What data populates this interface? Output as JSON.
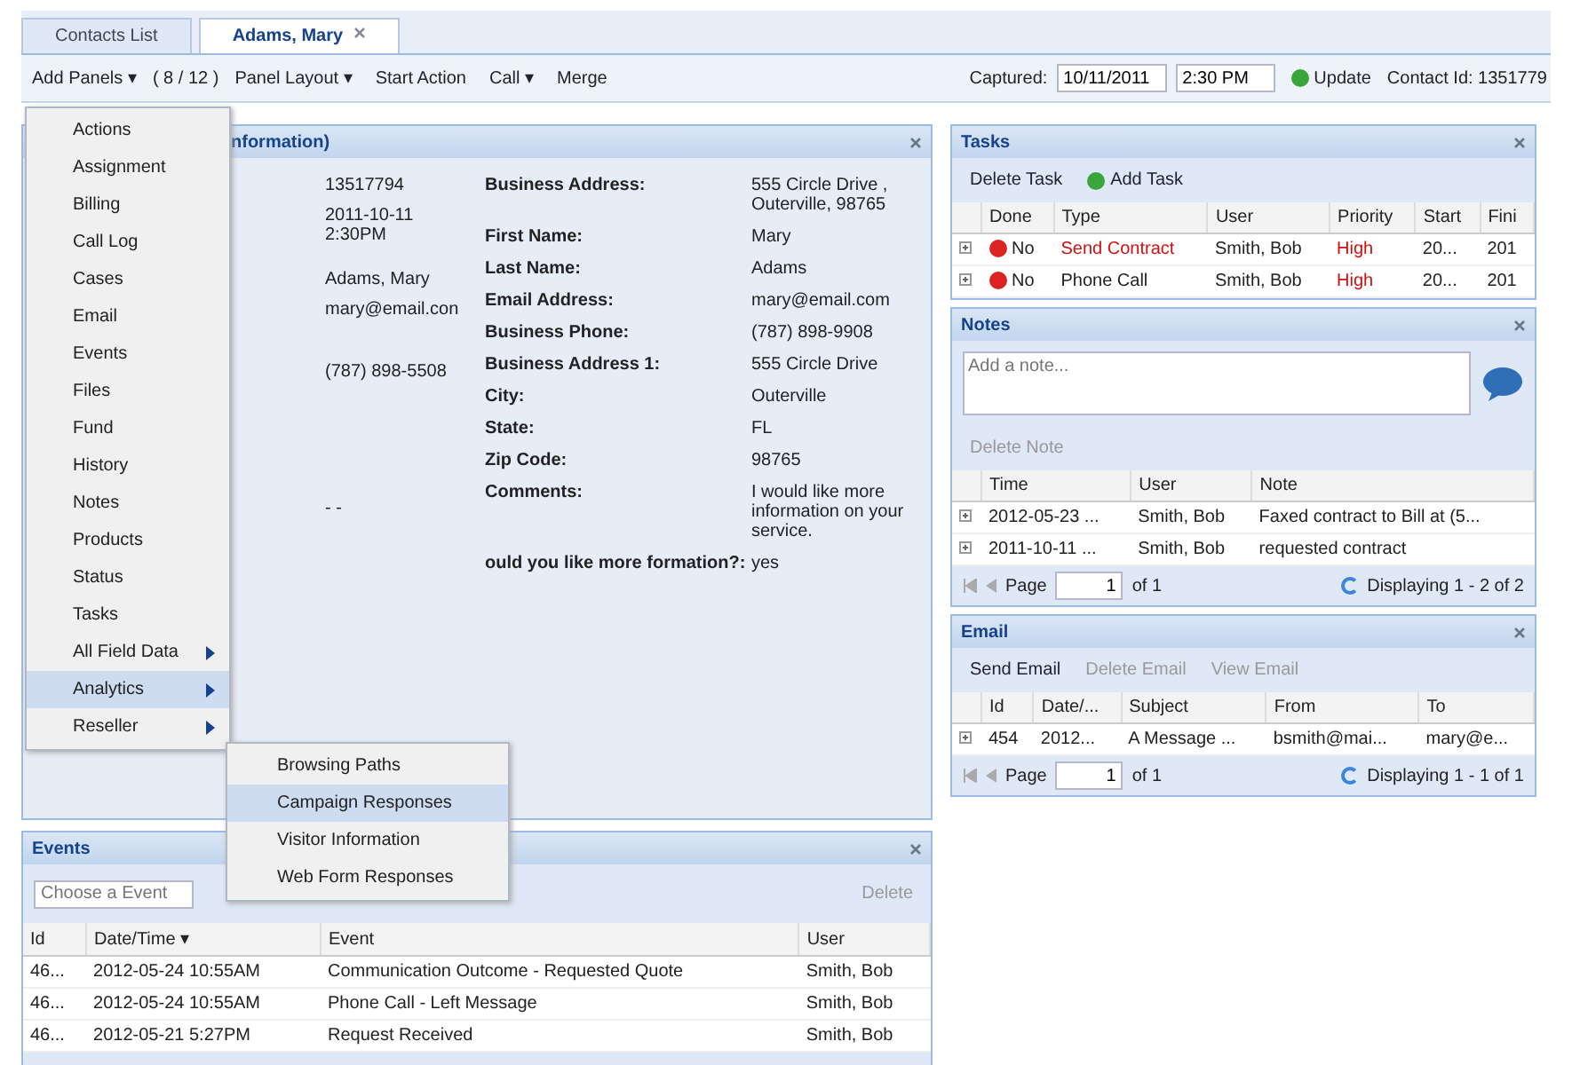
{
  "tabs": [
    {
      "label": "Contacts List",
      "selected": false,
      "closable": false
    },
    {
      "label": "Adams, Mary",
      "selected": true,
      "closable": true
    }
  ],
  "toolbar": {
    "add_panels": "Add Panels ▾",
    "panel_count": "( 8 / 12 )",
    "panel_layout": "Panel Layout ▾",
    "start_action": "Start Action",
    "call": "Call ▾",
    "merge": "Merge",
    "captured_label": "Captured:",
    "captured_date": "10/11/2011",
    "captured_time": "2:30 PM",
    "update": "Update",
    "contact_id": "Contact Id: 1351779"
  },
  "contact_panel": {
    "title": "nformation)",
    "left_values": [
      "13517794",
      "2011-10-11 2:30PM",
      "Adams, Mary",
      "mary@email.con",
      "(787) 898-5508",
      "- -"
    ],
    "fields": [
      {
        "label": "Business Address:",
        "value": "555 Circle Drive , Outerville, 98765"
      },
      {
        "label": "First Name:",
        "value": "Mary"
      },
      {
        "label": "Last Name:",
        "value": "Adams"
      },
      {
        "label": "Email Address:",
        "value": "mary@email.com"
      },
      {
        "label": "Business Phone:",
        "value": "(787) 898-9908"
      },
      {
        "label": "Business Address 1:",
        "value": "555 Circle Drive"
      },
      {
        "label": "City:",
        "value": "Outerville"
      },
      {
        "label": "State:",
        "value": "FL"
      },
      {
        "label": "Zip Code:",
        "value": "98765"
      },
      {
        "label": "Comments:",
        "value": "I would like more information on your service."
      },
      {
        "label": "ould you like more formation?:",
        "value": "yes"
      }
    ]
  },
  "events_panel": {
    "title": "Events",
    "combo_placeholder": "Choose a Event",
    "delete": "Delete",
    "columns": [
      "Id",
      "Date/Time ▾",
      "Event",
      "User"
    ],
    "rows": [
      [
        "46...",
        "2012-05-24 10:55AM",
        "Communication Outcome - Requested Quote",
        "Smith, Bob"
      ],
      [
        "46...",
        "2012-05-24 10:55AM",
        "Phone Call - Left Message",
        "Smith, Bob"
      ],
      [
        "46...",
        "2012-05-21 5:27PM",
        "Request Received",
        "Smith, Bob"
      ]
    ]
  },
  "menu": {
    "items": [
      {
        "label": "Actions",
        "kind": "item"
      },
      {
        "label": "Assignment",
        "kind": "item"
      },
      {
        "label": "Billing",
        "kind": "item"
      },
      {
        "label": "Call Log",
        "kind": "item"
      },
      {
        "label": "Cases",
        "kind": "item"
      },
      {
        "label": "Email",
        "kind": "item"
      },
      {
        "label": "Events",
        "kind": "item"
      },
      {
        "label": "Files",
        "kind": "item"
      },
      {
        "label": "Fund",
        "kind": "item"
      },
      {
        "label": "History",
        "kind": "item"
      },
      {
        "label": "Notes",
        "kind": "item"
      },
      {
        "label": "Products",
        "kind": "item"
      },
      {
        "label": "Status",
        "kind": "item"
      },
      {
        "label": "Tasks",
        "kind": "item"
      },
      {
        "label": "All Field Data",
        "kind": "submenu",
        "selected": false
      },
      {
        "label": "Analytics",
        "kind": "submenu",
        "selected": true
      },
      {
        "label": "Reseller",
        "kind": "submenu",
        "selected": false
      }
    ],
    "submenu": [
      {
        "label": "Browsing Paths",
        "selected": false
      },
      {
        "label": "Campaign Responses",
        "selected": true
      },
      {
        "label": "Visitor Information",
        "selected": false
      },
      {
        "label": "Web Form Responses",
        "selected": false
      }
    ]
  },
  "tasks_panel": {
    "title": "Tasks",
    "delete": "Delete Task",
    "add": "Add Task",
    "columns": [
      "Done",
      "Type",
      "User",
      "Priority",
      "Start",
      "Fini"
    ],
    "rows": [
      {
        "done": "No",
        "type": "Send Contract",
        "overdue": true,
        "user": "Smith, Bob",
        "priority": "High",
        "start": "20...",
        "finish": "201"
      },
      {
        "done": "No",
        "type": "Phone Call",
        "overdue": false,
        "user": "Smith, Bob",
        "priority": "High",
        "start": "20...",
        "finish": "201"
      }
    ]
  },
  "notes_panel": {
    "title": "Notes",
    "placeholder": "Add a note...",
    "delete": "Delete Note",
    "columns": [
      "Time",
      "User",
      "Note"
    ],
    "rows": [
      [
        "2012-05-23 ...",
        "Smith, Bob",
        "Faxed contract to Bill at (5..."
      ],
      [
        "2011-10-11 ...",
        "Smith, Bob",
        "requested contract"
      ]
    ],
    "pager": {
      "page_label": "Page",
      "page": "1",
      "of": "of 1",
      "display": "Displaying 1 - 2 of 2"
    }
  },
  "email_panel": {
    "title": "Email",
    "send": "Send Email",
    "delete": "Delete Email",
    "view": "View Email",
    "columns": [
      "Id",
      "Date/...",
      "Subject",
      "From",
      "To"
    ],
    "rows": [
      [
        "454",
        "2012...",
        "A Message ...",
        "bsmith@mai...",
        "mary@e..."
      ]
    ],
    "pager": {
      "page_label": "Page",
      "page": "1",
      "of": "of 1",
      "display": "Displaying 1 - 1 of 1"
    }
  }
}
